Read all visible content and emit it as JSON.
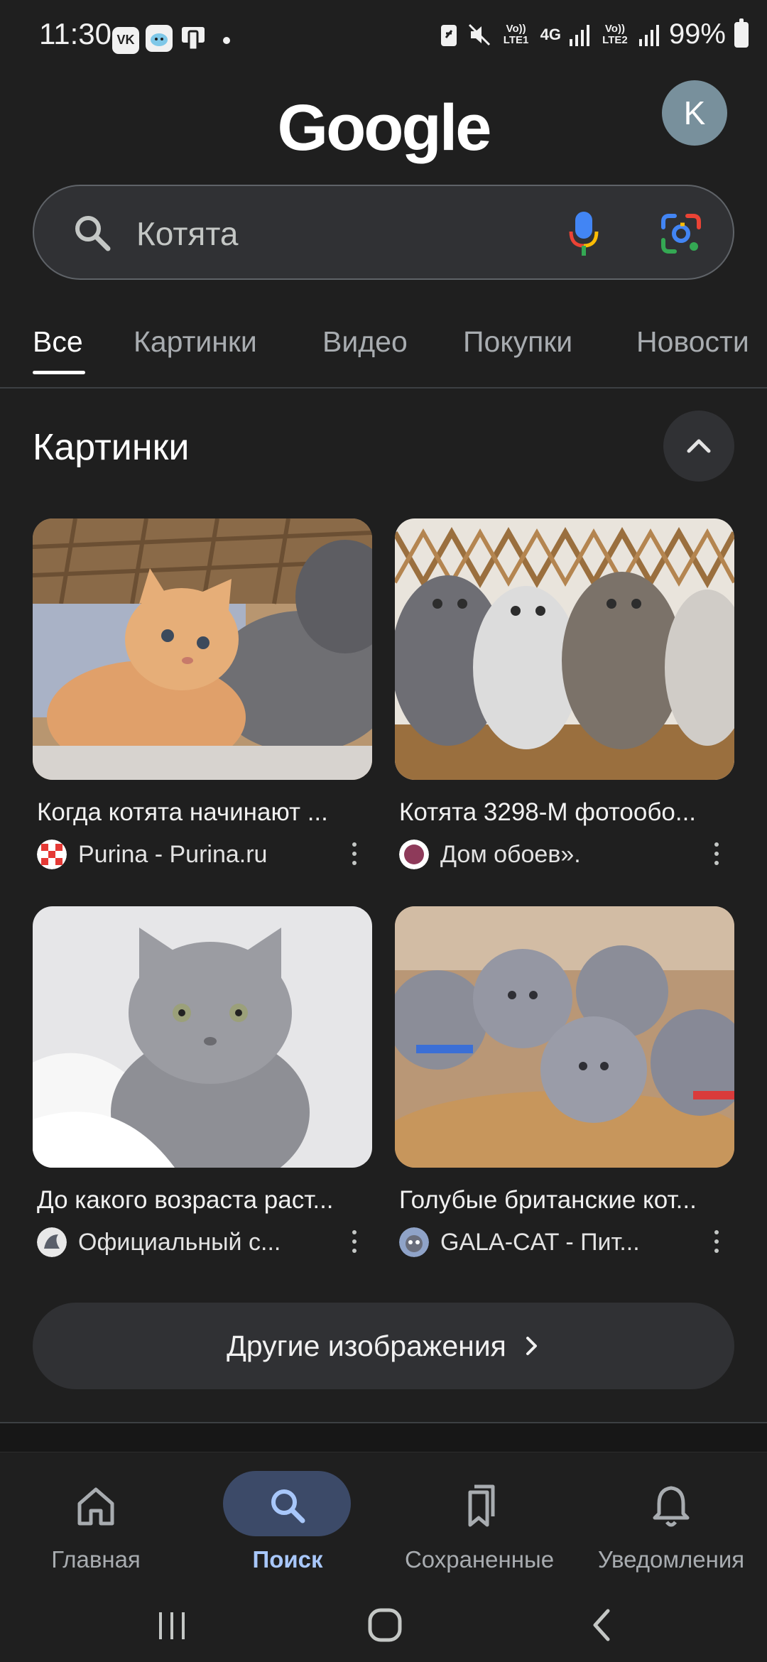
{
  "status_bar": {
    "time": "11:30",
    "app_icons": [
      "vk-icon",
      "cloud-app-icon",
      "device-app-icon"
    ],
    "volte1": "Vo)) LTE1",
    "network": "4G",
    "volte2": "Vo)) LTE2",
    "battery": "99%"
  },
  "header": {
    "logo": "Google",
    "avatar_letter": "K"
  },
  "search": {
    "query": "Котята"
  },
  "tabs": [
    {
      "label": "Все",
      "active": true
    },
    {
      "label": "Картинки",
      "active": false
    },
    {
      "label": "Видео",
      "active": false
    },
    {
      "label": "Покупки",
      "active": false
    },
    {
      "label": "Новости",
      "active": false
    }
  ],
  "images_section": {
    "title": "Картинки",
    "cards": [
      {
        "title": "Когда котята начинают ...",
        "source": "Purina - Purina.ru"
      },
      {
        "title": "Котята 3298-М фотообо...",
        "source": "Дом обоев»."
      },
      {
        "title": "До какого возраста раст...",
        "source": "Официальный с..."
      },
      {
        "title": "Голубые британские кот...",
        "source": "GALA-CAT - Пит..."
      }
    ],
    "more_button": "Другие изображения"
  },
  "bottom_nav": [
    {
      "label": "Главная",
      "icon": "home-icon",
      "active": false
    },
    {
      "label": "Поиск",
      "icon": "search-icon",
      "active": true
    },
    {
      "label": "Сохраненные",
      "icon": "bookmarks-icon",
      "active": false
    },
    {
      "label": "Уведомления",
      "icon": "bell-icon",
      "active": false
    }
  ],
  "colors": {
    "background": "#1f1f1f",
    "search_bar": "#303134",
    "active_nav_pill": "#3c4a68",
    "active_nav_label": "#a8c7fa",
    "avatar": "#78909c"
  }
}
